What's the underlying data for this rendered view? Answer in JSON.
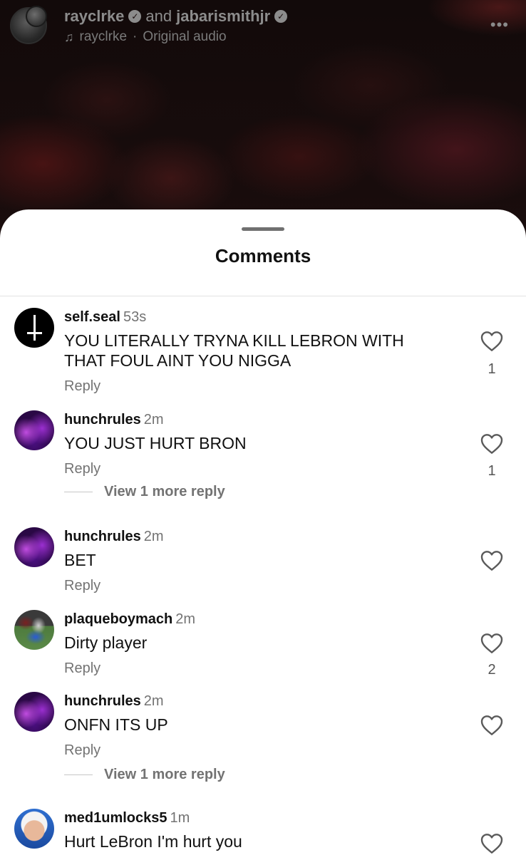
{
  "reel": {
    "user1": "rayclrke",
    "and_text": "and",
    "user2": "jabarismithjr",
    "audio_user": "rayclrke",
    "audio_sep": "·",
    "audio_label": "Original audio"
  },
  "sheet": {
    "title": "Comments"
  },
  "comments": [
    {
      "user": "self.seal",
      "time": "53s",
      "text": "YOU LITERALLY TRYNA KILL LEBRON WITH THAT FOUL AINT YOU NIGGA",
      "reply": "Reply",
      "likes": "1"
    },
    {
      "user": "hunchrules",
      "time": "2m",
      "text": "YOU JUST HURT BRON",
      "reply": "Reply",
      "likes": "1",
      "view_more": "View 1 more reply"
    },
    {
      "user": "hunchrules",
      "time": "2m",
      "text": "BET",
      "reply": "Reply"
    },
    {
      "user": "plaqueboymach",
      "time": "2m",
      "text": "Dirty player",
      "reply": "Reply",
      "likes": "2"
    },
    {
      "user": "hunchrules",
      "time": "2m",
      "text": "ONFN ITS UP",
      "reply": "Reply",
      "view_more": "View 1 more reply"
    },
    {
      "user": "med1umlocks5",
      "time": "1m",
      "text": "Hurt LeBron I'm hurt you"
    }
  ],
  "icons": {
    "verified": "verified-badge-icon",
    "audio": "music-note-icon",
    "more": "more-options-icon",
    "like": "heart-icon"
  }
}
